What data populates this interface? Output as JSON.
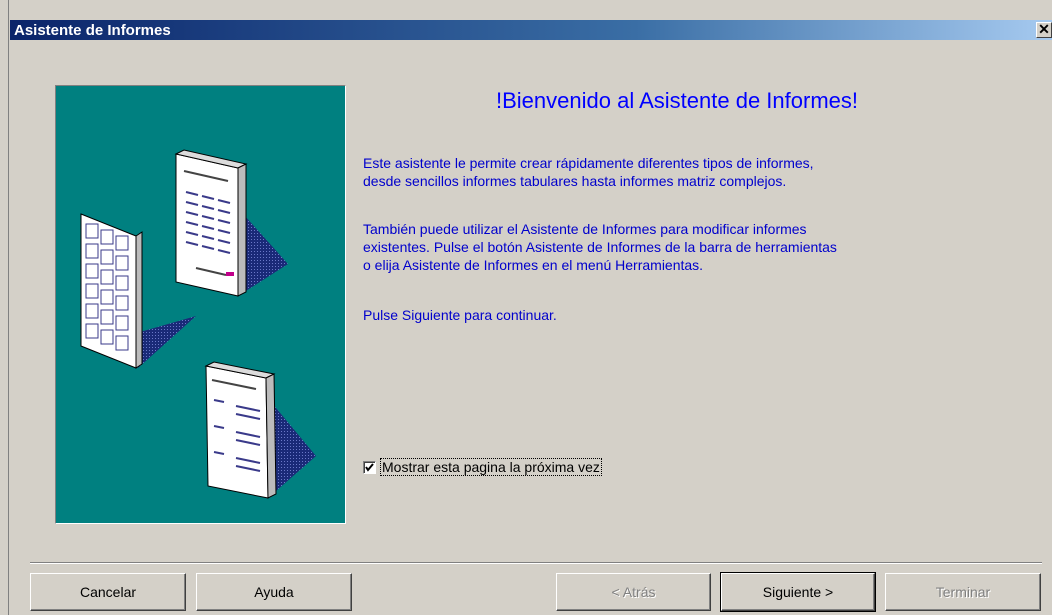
{
  "window": {
    "title": "Asistente de Informes",
    "close_glyph": "✕"
  },
  "main": {
    "heading": "!Bienvenido al Asistente de Informes!",
    "paragraph1": "Este asistente le permite crear rápidamente diferentes tipos de informes,\ndesde sencillos informes tabulares hasta informes matriz complejos.",
    "paragraph2": "También puede utilizar el Asistente de Informes para modificar informes\nexistentes. Pulse el botón Asistente de Informes de la barra de herramientas\no elija Asistente de Informes en el menú Herramientas.",
    "paragraph3": "Pulse Siguiente para continuar.",
    "show_again_label": "Mostrar esta pagina la próxima vez",
    "show_again_checked": true
  },
  "buttons": {
    "cancel": "Cancelar",
    "help": "Ayuda",
    "back": "< Atrás",
    "next": "Siguiente >",
    "finish": "Terminar"
  },
  "colors": {
    "title_bar": "#0a246a",
    "illustration_bg": "#008080",
    "text_blue": "#0000cc"
  }
}
